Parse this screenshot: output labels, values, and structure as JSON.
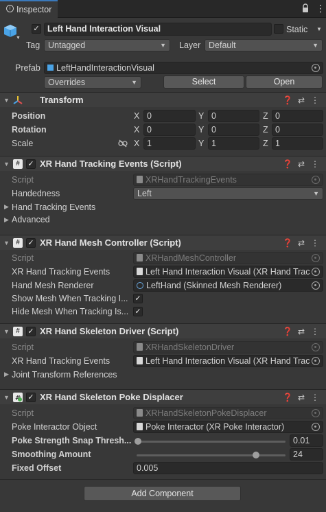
{
  "tab": {
    "title": "Inspector",
    "lock_icon": "lock-icon",
    "menu_icon": "kebab-menu-icon"
  },
  "gameobject": {
    "name": "Left Hand Interaction Visual",
    "active": true,
    "static_label": "Static",
    "tag_label": "Tag",
    "tag_value": "Untagged",
    "layer_label": "Layer",
    "layer_value": "Default",
    "prefab_label": "Prefab",
    "prefab_value": "LeftHandInteractionVisual",
    "overrides_label": "Overrides",
    "select_label": "Select",
    "open_label": "Open"
  },
  "transform": {
    "title": "Transform",
    "rows": [
      {
        "label": "Position",
        "x": "0",
        "y": "0",
        "z": "0"
      },
      {
        "label": "Rotation",
        "x": "0",
        "y": "0",
        "z": "0"
      },
      {
        "label": "Scale",
        "x": "1",
        "y": "1",
        "z": "1"
      }
    ],
    "axis": {
      "x": "X",
      "y": "Y",
      "z": "Z"
    }
  },
  "tracking_events": {
    "title": "XR Hand Tracking Events (Script)",
    "script_label": "Script",
    "script_value": "XRHandTrackingEvents",
    "handedness_label": "Handedness",
    "handedness_value": "Left",
    "foldout1": "Hand Tracking Events",
    "foldout2": "Advanced"
  },
  "mesh_controller": {
    "title": "XR Hand Mesh Controller (Script)",
    "script_label": "Script",
    "script_value": "XRHandMeshController",
    "events_label": "XR Hand Tracking Events",
    "events_value": "Left Hand Interaction Visual (XR Hand Trac",
    "renderer_label": "Hand Mesh Renderer",
    "renderer_value": "LeftHand (Skinned Mesh Renderer)",
    "show_label": "Show Mesh When Tracking I...",
    "hide_label": "Hide Mesh When Tracking Is..."
  },
  "skeleton_driver": {
    "title": "XR Hand Skeleton Driver (Script)",
    "script_label": "Script",
    "script_value": "XRHandSkeletonDriver",
    "events_label": "XR Hand Tracking Events",
    "events_value": "Left Hand Interaction Visual (XR Hand Trac",
    "foldout": "Joint Transform References"
  },
  "poke_displacer": {
    "title": "XR Hand Skeleton Poke Displacer",
    "script_label": "Script",
    "script_value": "XRHandSkeletonPokeDisplacer",
    "interactor_label": "Poke Interactor Object",
    "interactor_value": "Poke Interactor (XR Poke Interactor)",
    "snap_label": "Poke Strength Snap Thresh...",
    "snap_value": "0.01",
    "snap_level": 0.01,
    "smooth_label": "Smoothing Amount",
    "smooth_value": "24",
    "smooth_level": 0.8,
    "offset_label": "Fixed Offset",
    "offset_value": "0.005"
  },
  "add_component_label": "Add Component",
  "colors": {
    "panel": "#383838",
    "header": "#3e3e3e",
    "field": "#2a2a2a",
    "button": "#585858"
  }
}
